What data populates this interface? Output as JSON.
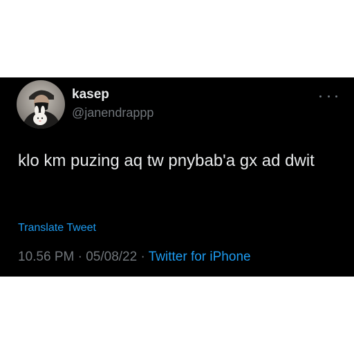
{
  "colors": {
    "card_background": "#000000",
    "page_background": "#ffffff",
    "primary_text": "#e7e9ea",
    "secondary_text": "#71767b",
    "accent": "#1d9bf0"
  },
  "author": {
    "display_name": "kasep",
    "handle": "@janendrappp",
    "avatar_icon": "avatar-photo"
  },
  "more_options_icon": "more-horizontal-icon",
  "tweet": {
    "text": "klo km puzing aq tw pnybab'a gx ad dwit",
    "translate_label": "Translate Tweet",
    "time": "10.56 PM",
    "separator": " · ",
    "date": "05/08/22",
    "source": "Twitter for iPhone"
  }
}
